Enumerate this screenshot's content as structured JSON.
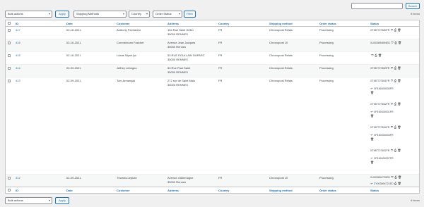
{
  "search": {
    "placeholder": "",
    "button_label": "Search"
  },
  "filters": {
    "bulk_actions": "Bulk actions",
    "apply": "Apply",
    "shipping_methods": "Shipping Methods",
    "country": "Country",
    "order_status": "Order Status",
    "filter": "Filter"
  },
  "items_count": "6 items",
  "columns": [
    "ID",
    "Date",
    "Customer",
    "Address",
    "Country",
    "Shipping method",
    "Order status",
    "Status"
  ],
  "rows": [
    {
      "id": "417",
      "date": "02-16-2021",
      "customer": "Anthony Pechanfar",
      "address": "154 Rue Saint Hélier\n35000 RENNES",
      "country": "FR",
      "shipping": "Chronopost Relais",
      "order_status": "Processing",
      "status": [
        {
          "code": "XT987727680FR",
          "type": "tracking"
        }
      ]
    },
    {
      "id": "416",
      "date": "02-16-2021",
      "customer": "Corentchuan Fraichet",
      "address": "Avenue Jean Jacques\n35000 Rennes",
      "country": "FR",
      "shipping": "Chronopost 10",
      "order_status": "Processing",
      "status": [
        {
          "code": "XU003894694ED",
          "type": "tracking"
        }
      ]
    },
    {
      "id": "415",
      "date": "02-16-2021",
      "customer": "Lukas Slyah-lyu",
      "address": "53 RUE POULLAIN DUPARC\n35000 RENNES",
      "country": "FR",
      "shipping": "Chronopost Relais",
      "order_status": "Processing",
      "status": [
        {
          "code": "",
          "type": "tracking"
        }
      ]
    },
    {
      "id": "414",
      "date": "02-09-2021",
      "customer": "Jeffrey Lebegno",
      "address": "53 Rue Paul Saint\n35000 RENNES",
      "country": "FR",
      "shipping": "Chronopost Relais",
      "order_status": "Processing",
      "status": [
        {
          "code": "XT987727660FR",
          "type": "tracking"
        }
      ]
    },
    {
      "id": "413",
      "date": "02-09-2021",
      "customer": "Tom Armangat",
      "address": "272 rue de Saint Malo\n35000 RENNES",
      "country": "FR",
      "shipping": "Chronopost Relais",
      "order_status": "Processing",
      "status": [
        {
          "code": "XT987727651FR",
          "type": "tracking"
        },
        {
          "code": "XP160430030FR",
          "type": "return"
        },
        {
          "code": "XT987727652FR",
          "type": "tracking"
        },
        {
          "code": "XP160430031FR",
          "type": "return"
        },
        {
          "code": "XT987727654FR",
          "type": "tracking"
        },
        {
          "code": "XP160430033FR",
          "type": "return"
        },
        {
          "code": "XT987727657FR",
          "type": "tracking"
        },
        {
          "code": "XP160430037FR",
          "type": "return"
        }
      ]
    },
    {
      "id": "412",
      "date": "02-09-2021",
      "customer": "Thomas Lepiote",
      "address": "Avenue d'Allemagne\n35000 Rennes",
      "country": "FR",
      "shipping": "Chronopost 10",
      "order_status": "Processing",
      "status": [
        {
          "code": "XU003894720ED",
          "type": "tracking"
        },
        {
          "code": "ZY003894721ED",
          "type": "return"
        }
      ]
    }
  ],
  "icons": {
    "shield": "shield-icon",
    "print": "print-icon",
    "trash": "trash-icon",
    "return": "return-arrow-icon"
  },
  "colors": {
    "link": "#2271b1",
    "background": "#f0f0f1"
  }
}
